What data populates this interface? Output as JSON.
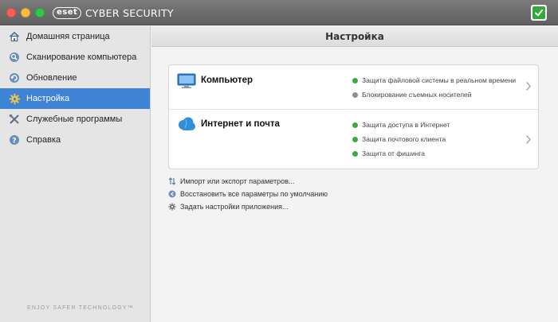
{
  "window": {
    "app_title": "CYBER SECURITY",
    "logo_text": "eset"
  },
  "sidebar": {
    "items": [
      {
        "label": "Домашняя страница",
        "icon": "home-icon",
        "active": false
      },
      {
        "label": "Сканирование компьютера",
        "icon": "scan-icon",
        "active": false
      },
      {
        "label": "Обновление",
        "icon": "update-icon",
        "active": false
      },
      {
        "label": "Настройка",
        "icon": "settings-gear-icon",
        "active": true
      },
      {
        "label": "Служебные программы",
        "icon": "tools-icon",
        "active": false
      },
      {
        "label": "Справка",
        "icon": "help-icon",
        "active": false
      }
    ],
    "footer": "ENJOY SAFER TECHNOLOGY™"
  },
  "main": {
    "title": "Настройка",
    "sections": [
      {
        "title": "Компьютер",
        "icon": "monitor-icon",
        "features": [
          {
            "label": "Защита файловой системы в реальном времени",
            "status": "green"
          },
          {
            "label": "Блокирование съемных носителей",
            "status": "gray"
          }
        ]
      },
      {
        "title": "Интернет и почта",
        "icon": "cloud-icon",
        "features": [
          {
            "label": "Защита доступа в Интернет",
            "status": "green"
          },
          {
            "label": "Защита почтового клиента",
            "status": "green"
          },
          {
            "label": "Защита от фишинга",
            "status": "green"
          }
        ]
      }
    ],
    "actions": [
      {
        "label": "Импорт или экспорт параметров...",
        "icon": "import-export-icon"
      },
      {
        "label": "Восстановить все параметры по умолчанию",
        "icon": "restore-icon"
      },
      {
        "label": "Задать настройки приложения...",
        "icon": "gear-icon"
      }
    ]
  },
  "colors": {
    "accent": "#3f83d5",
    "status_ok": "#3daa3f",
    "status_off": "#8e8e8e"
  }
}
